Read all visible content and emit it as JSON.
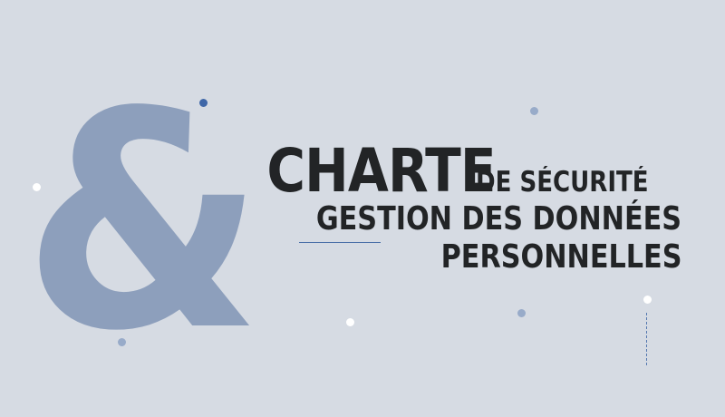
{
  "banner": {
    "ampersand": "&",
    "title_main": "CHARTE",
    "title_suffix": "DE SÉCURITÉ",
    "subtitle_line1": "GESTION DES DONNÉES",
    "subtitle_line2": "PERSONNELLES"
  },
  "colors": {
    "background": "#d6dbe3",
    "ampersand": "#8d9fbc",
    "text": "#222426",
    "accent_blue": "#3f67a8",
    "dot_light_blue": "#98abc9",
    "dot_white": "#ffffff"
  }
}
